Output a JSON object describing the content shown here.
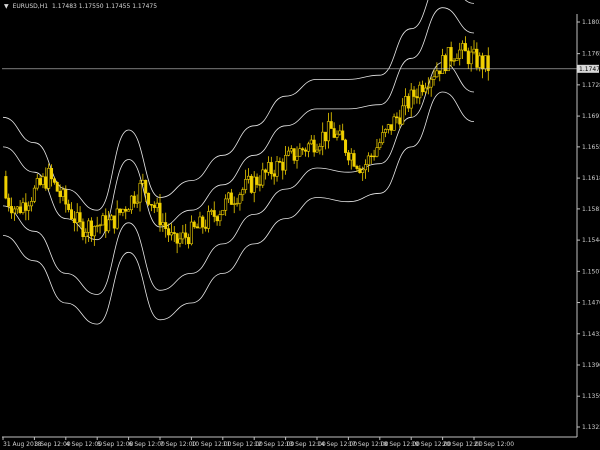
{
  "header": {
    "arrow": "▼",
    "symbol": "EURUSD,H1",
    "ohlc": "1.17483 1.17550 1.17455 1.17475"
  },
  "price_axis": {
    "labels": [
      "1.18030",
      "1.17655",
      "1.17285",
      "1.16915",
      "1.16550",
      "1.16180",
      "1.15815",
      "1.15445",
      "1.15075",
      "1.14705",
      "1.14335",
      "1.13965",
      "1.13595",
      "1.13230"
    ],
    "current_label": "1.17475",
    "current_value": 1.17475
  },
  "time_axis": {
    "labels": [
      "31 Aug 2018",
      "3 Sep 12:00",
      "4 Sep 12:00",
      "5 Sep 12:00",
      "6 Sep 12:00",
      "7 Sep 12:00",
      "10 Sep 12:00",
      "11 Sep 12:00",
      "12 Sep 12:00",
      "13 Sep 12:00",
      "14 Sep 12:00",
      "17 Sep 12:00",
      "18 Sep 12:00",
      "19 Sep 12:00",
      "20 Sep 12:00",
      "21 Sep 12:00"
    ]
  },
  "colors": {
    "background": "#000000",
    "candle": "#f0d000",
    "envelope": "#e8e8e8",
    "crosshair": "#c8c8c8",
    "axis": "#c0c0c0",
    "text": "#d0d0d0"
  },
  "chart_data": {
    "type": "line",
    "title": "EURUSD,H1",
    "xlabel": "",
    "ylabel": "",
    "ylim": [
      1.131,
      1.182
    ],
    "x": [
      "31 Aug 2018",
      "3 Sep 12:00",
      "4 Sep 12:00",
      "5 Sep 12:00",
      "6 Sep 12:00",
      "7 Sep 12:00",
      "10 Sep 12:00",
      "11 Sep 12:00",
      "12 Sep 12:00",
      "13 Sep 12:00",
      "14 Sep 12:00",
      "17 Sep 12:00",
      "18 Sep 12:00",
      "19 Sep 12:00",
      "20 Sep 12:00",
      "21 Sep 12:00"
    ],
    "series": [
      {
        "values": [
          1.158,
          1.162,
          1.156,
          1.1565,
          1.161,
          1.154,
          1.1565,
          1.16,
          1.1625,
          1.165,
          1.1675,
          1.163,
          1.1685,
          1.1735,
          1.177,
          1.175
        ]
      },
      {
        "values": [
          1.162,
          1.159,
          1.154,
          1.151,
          1.16,
          1.152,
          1.154,
          1.1575,
          1.161,
          1.1635,
          1.1665,
          1.1665,
          1.167,
          1.1725,
          1.179,
          1.1755
        ]
      },
      {
        "values": [
          1.1655,
          1.1625,
          1.157,
          1.1545,
          1.164,
          1.156,
          1.158,
          1.161,
          1.1645,
          1.168,
          1.17,
          1.17,
          1.1705,
          1.176,
          1.182,
          1.179
        ]
      },
      {
        "values": [
          1.1585,
          1.1555,
          1.1505,
          1.148,
          1.1565,
          1.1485,
          1.1505,
          1.154,
          1.1575,
          1.1605,
          1.163,
          1.1625,
          1.1635,
          1.169,
          1.1755,
          1.172
        ]
      },
      {
        "values": [
          1.169,
          1.166,
          1.1605,
          1.158,
          1.1675,
          1.1595,
          1.1615,
          1.1645,
          1.168,
          1.1715,
          1.1735,
          1.1735,
          1.174,
          1.1795,
          1.1855,
          1.1825
        ]
      },
      {
        "values": [
          1.155,
          1.152,
          1.147,
          1.1445,
          1.153,
          1.145,
          1.147,
          1.1505,
          1.154,
          1.157,
          1.1595,
          1.159,
          1.16,
          1.1655,
          1.172,
          1.1685
        ]
      }
    ]
  }
}
